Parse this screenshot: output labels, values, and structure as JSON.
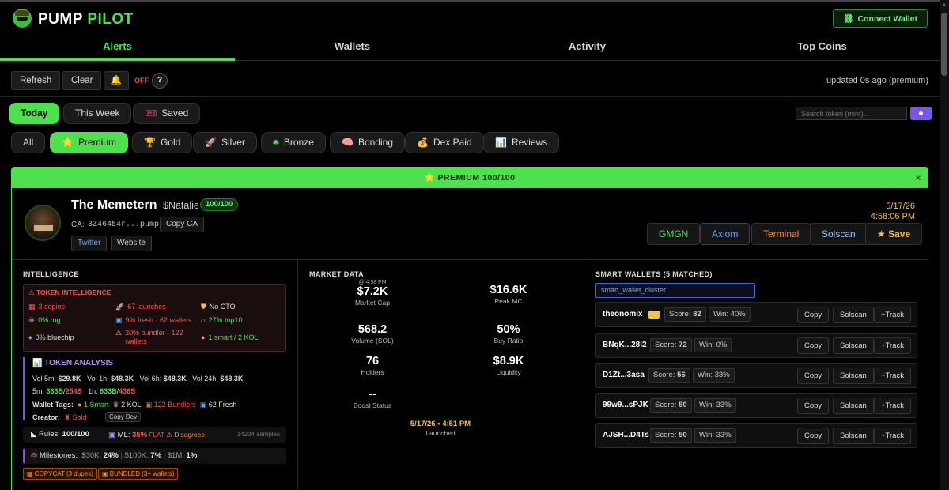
{
  "app": {
    "brand_part1": "PUMP",
    "brand_part2": "PILOT",
    "connect_label": "Connect Wallet"
  },
  "tabs": [
    "Alerts",
    "Wallets",
    "Activity",
    "Top Coins"
  ],
  "controls": {
    "refresh": "Refresh",
    "clear": "Clear",
    "off": "OFF",
    "help": "?",
    "updated": "updated 0s ago (premium)"
  },
  "periods": [
    "Today",
    "This Week",
    "Saved"
  ],
  "filters": [
    "All",
    "Premium",
    "Gold",
    "Silver",
    "Bronze",
    "Bonding",
    "Dex Paid",
    "Reviews"
  ],
  "search": {
    "placeholder": "Search token (mint)..."
  },
  "card": {
    "banner": "PREMIUM 100/100",
    "name": "The Memetern",
    "symbol": "$Natalie",
    "score": "100/100",
    "ca_label": "CA:",
    "ca": "3Z46454r...pump",
    "copy_ca": "Copy CA",
    "twitter": "Twitter",
    "website": "Website",
    "date": "5/17/26",
    "time": "4:58:06 PM",
    "ext": [
      "GMGN",
      "Axiom",
      "Terminal",
      "Solscan",
      "Save"
    ]
  },
  "intel": {
    "title": "INTELLIGENCE",
    "box_title": "TOKEN INTELLIGENCE",
    "items": [
      "3 copies",
      "67 launches",
      "No CTO",
      "0% rug",
      "9% fresh · 62 wallets",
      "27% top10",
      "0% bluechip",
      "30% bundler · 122 wallets",
      "1 smart / 2 KOL"
    ],
    "analysis_title": "TOKEN ANALYSIS",
    "vol_5m_label": "Vol 5m:",
    "vol_5m": "$29.8K",
    "vol_1h_label": "Vol 1h:",
    "vol_1h": "$48.3K",
    "vol_6h_label": "Vol 6h:",
    "vol_6h": "$48.3K",
    "vol_24h_label": "Vol 24h:",
    "vol_24h": "$48.3K",
    "t5m_label": "5m:",
    "t5m_buy": "363B",
    "t5m_sell": "254S",
    "t1h_label": "1h:",
    "t1h_buy": "633B",
    "t1h_sell": "436S",
    "wallet_tags_label": "Wallet Tags:",
    "tag_smart": "1 Smart",
    "tag_kol": "2 KOL",
    "tag_bundlers": "122 Bundlers",
    "tag_fresh": "62 Fresh",
    "creator_label": "Creator:",
    "creator_sold": "Sold",
    "copy_dev": "Copy Dev",
    "rules_label": "Rules:",
    "rules_val": "100/100",
    "ml_label": "ML:",
    "ml_val": "35%",
    "ml_flat": "FLAT",
    "ml_dis": "Disagrees",
    "samples": "14234 samples",
    "milestones_label": "Milestones:",
    "m30": "$30K:",
    "m30v": "24%",
    "m100": "$100K:",
    "m100v": "7%",
    "m1m": "$1M:",
    "m1mv": "1%",
    "tags": [
      "COPYCAT (3 dupes)",
      "BUNDLED (3+ wallets)"
    ]
  },
  "market": {
    "title": "MARKET DATA",
    "mc_time": "@ 4:58 PM",
    "mc": "$7.2K",
    "mc_label": "Market Cap",
    "peak": "$16.6K",
    "peak_label": "Peak MC",
    "vol": "568.2",
    "vol_label": "Volume (SOL)",
    "buy": "50%",
    "buy_label": "Buy Ratio",
    "holders": "76",
    "holders_label": "Holders",
    "liq": "$8.9K",
    "liq_label": "Liquidity",
    "boost": "--",
    "boost_label": "Boost Status",
    "launched": "5/17/26 • 4:51 PM",
    "launched_label": "Launched"
  },
  "smart": {
    "title": "SMART WALLETS (5 MATCHED)",
    "cluster": "smart_wallet_cluster",
    "score_label": "Score:",
    "win_label": "Win:",
    "copy": "Copy",
    "solscan": "Solscan",
    "track": "+Track",
    "wallets": [
      {
        "name": "theonomix",
        "score": "82",
        "win": "40%"
      },
      {
        "name": "BNqK...28i2",
        "score": "72",
        "win": "0%"
      },
      {
        "name": "D1Zt...3asa",
        "score": "56",
        "win": "33%"
      },
      {
        "name": "99w9...sPJK",
        "score": "50",
        "win": "33%"
      },
      {
        "name": "AJSH...D4Ts",
        "score": "50",
        "win": "33%"
      }
    ]
  },
  "colors": {
    "accent": "#4ee14e",
    "gold": "#f3c24a",
    "danger": "#ff4545"
  }
}
